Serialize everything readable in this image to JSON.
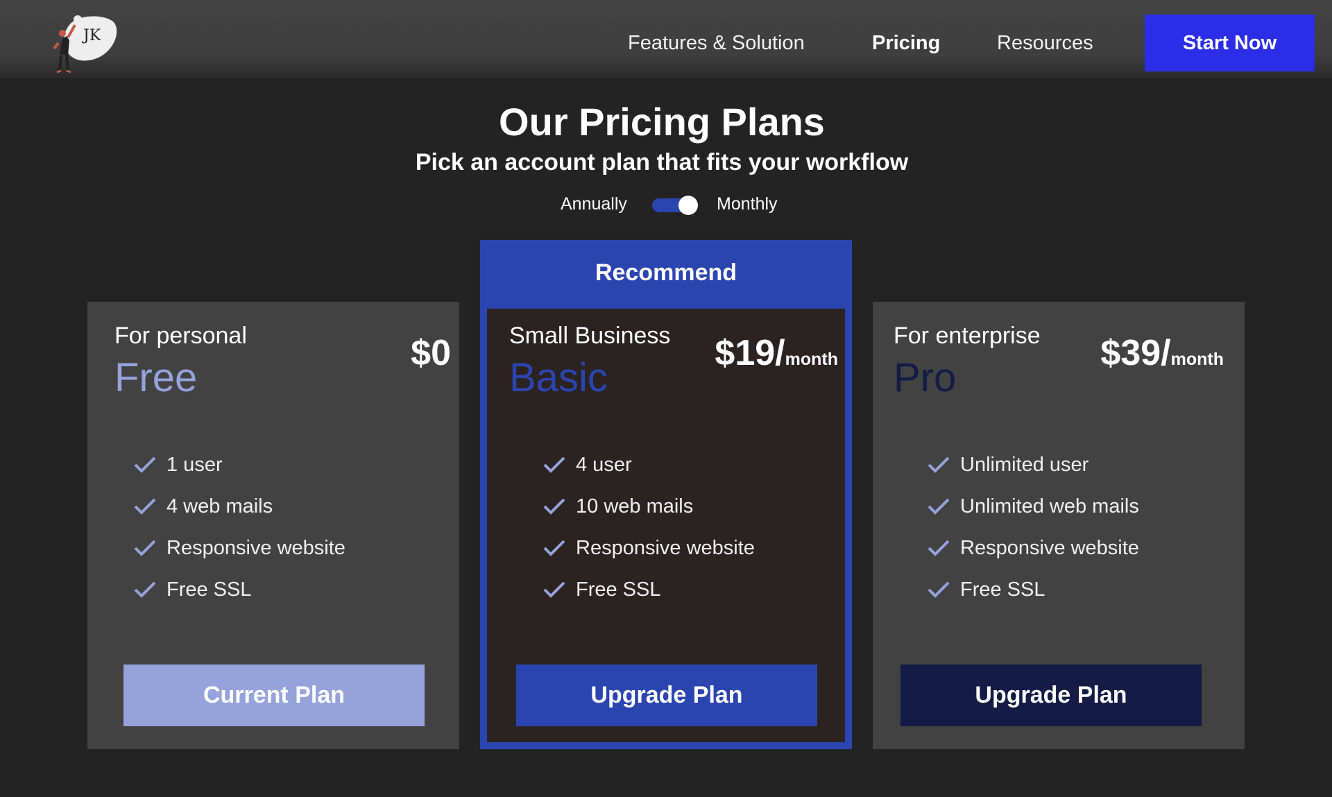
{
  "header": {
    "logo_text": "JK",
    "nav": [
      {
        "label": "Features & Solution"
      },
      {
        "label": "Pricing"
      },
      {
        "label": "Resources"
      }
    ],
    "cta_label": "Start Now"
  },
  "hero": {
    "title": "Our Pricing Plans",
    "subtitle": "Pick an account plan that fits your workflow"
  },
  "billing_toggle": {
    "left_label": "Annually",
    "right_label": "Monthly",
    "selected": "Monthly"
  },
  "plans": [
    {
      "for": "For personal",
      "name": "Free",
      "price": "$0",
      "period": "",
      "features": [
        "1 user",
        "4 web mails",
        "Responsive website",
        "Free SSL"
      ],
      "button": "Current Plan",
      "name_color": "#96a3db",
      "button_color": "#96a3db"
    },
    {
      "badge": "Recommend",
      "for": "Small Business",
      "name": "Basic",
      "price": "$19/",
      "period": "month",
      "features": [
        "4 user",
        "10 web mails",
        "Responsive website",
        "Free SSL"
      ],
      "button": "Upgrade Plan",
      "name_color": "#2b45b0",
      "button_color": "#2b45b0"
    },
    {
      "for": "For enterprise",
      "name": "Pro",
      "price": "$39/",
      "period": "month",
      "features": [
        "Unlimited user",
        "Unlimited web mails",
        "Responsive website",
        "Free SSL"
      ],
      "button": "Upgrade Plan",
      "name_color": "#141b45",
      "button_color": "#141b45"
    }
  ],
  "colors": {
    "background": "#232323",
    "accent": "#2b2ee6",
    "check": "#96a3db"
  }
}
